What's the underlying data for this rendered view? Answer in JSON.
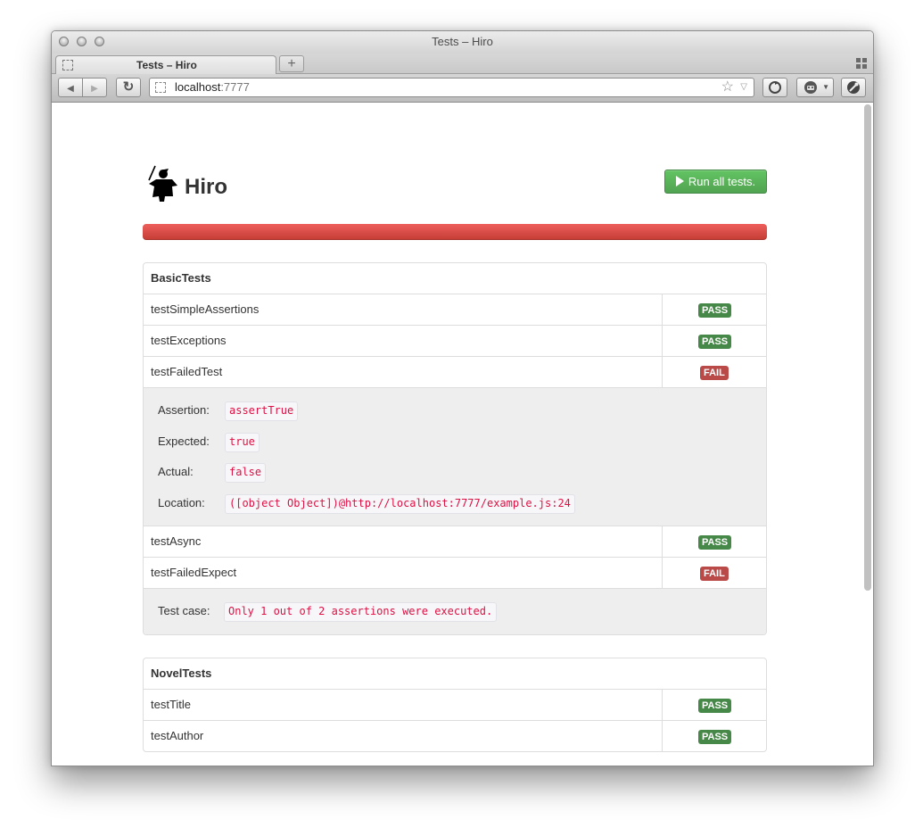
{
  "window": {
    "title": "Tests – Hiro",
    "tab_title": "Tests – Hiro",
    "new_tab_label": "+"
  },
  "toolbar": {
    "url_host": "localhost",
    "url_port": ":7777",
    "star_glyph": "☆",
    "url_menu_glyph": "▽",
    "back_glyph": "◀",
    "forward_glyph": "▶",
    "reload_glyph": "↻"
  },
  "header": {
    "brand": "Hiro",
    "run_button": "Run all tests."
  },
  "progress": {
    "failed": true,
    "fill_fraction": 1.0,
    "color": "#d9534f"
  },
  "suites": [
    {
      "name": "BasicTests",
      "tests": [
        {
          "name": "testSimpleAssertions",
          "status": "PASS"
        },
        {
          "name": "testExceptions",
          "status": "PASS"
        },
        {
          "name": "testFailedTest",
          "status": "FAIL",
          "details": [
            {
              "label": "Assertion:",
              "value": "assertTrue"
            },
            {
              "label": "Expected:",
              "value": "true"
            },
            {
              "label": "Actual:",
              "value": "false"
            },
            {
              "label": "Location:",
              "value": "([object Object])@http://localhost:7777/example.js:24"
            }
          ]
        },
        {
          "name": "testAsync",
          "status": "PASS"
        },
        {
          "name": "testFailedExpect",
          "status": "FAIL",
          "details": [
            {
              "label": "Test case:",
              "value": "Only 1 out of 2 assertions were executed."
            }
          ]
        }
      ]
    },
    {
      "name": "NovelTests",
      "tests": [
        {
          "name": "testTitle",
          "status": "PASS"
        },
        {
          "name": "testAuthor",
          "status": "PASS"
        }
      ]
    }
  ],
  "colors": {
    "pass": "#468847",
    "fail": "#b94a48",
    "run_button": "#5bb75b",
    "code_text": "#dd1144"
  }
}
